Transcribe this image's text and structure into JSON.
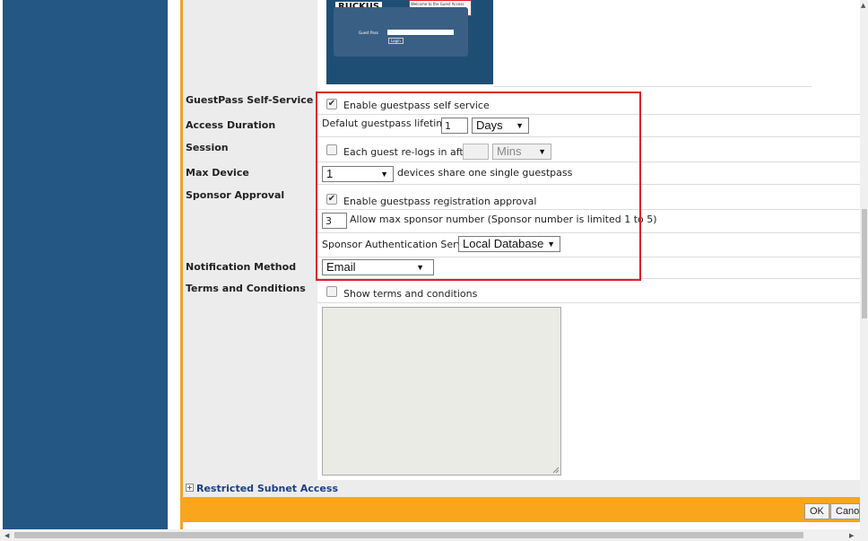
{
  "preview": {
    "brand": "RUCKUS",
    "welcome": "Welcome to the Guest Access login page.",
    "field_label": "Guest Pass",
    "login_button": "Login"
  },
  "form": {
    "labels": {
      "self_service": "GuestPass Self-Service",
      "access_duration": "Access Duration",
      "session": "Session",
      "max_device": "Max Device",
      "sponsor_approval": "Sponsor Approval",
      "notification_method": "Notification Method",
      "terms": "Terms and Conditions"
    },
    "self_service": {
      "checked": true,
      "label": "Enable guestpass self service"
    },
    "access_duration": {
      "label": "Defalut guestpass lifetime",
      "value": "1",
      "unit": "Days"
    },
    "session": {
      "checked": false,
      "label": "Each guest re-logs in after",
      "value": "",
      "unit": "Mins"
    },
    "max_device": {
      "value": "1",
      "suffix": "devices share one single guestpass"
    },
    "sponsor_approval": {
      "checked": true,
      "label": "Enable guestpass registration approval",
      "max_value": "3",
      "max_label": "Allow max sponsor number (Sponsor number is limited 1 to 5)",
      "auth_label": "Sponsor Authentication Server",
      "auth_value": "Local Database"
    },
    "notification": {
      "value": "Email"
    },
    "terms": {
      "checked": false,
      "label": "Show terms and conditions"
    }
  },
  "restricted_subnet": {
    "label": "Restricted Subnet Access",
    "toggle": "+"
  },
  "footer": {
    "ok_label": "OK",
    "cancel_label": "Cano"
  },
  "icons": {
    "checked_mark": "✔",
    "dropdown_arrow": "▼",
    "scroll_up": "▲",
    "scroll_left": "◀",
    "scroll_right": "▶"
  },
  "colors": {
    "sidebar": "#245784",
    "accent_orange": "#f9a61d",
    "highlight_red": "#e01f26"
  }
}
